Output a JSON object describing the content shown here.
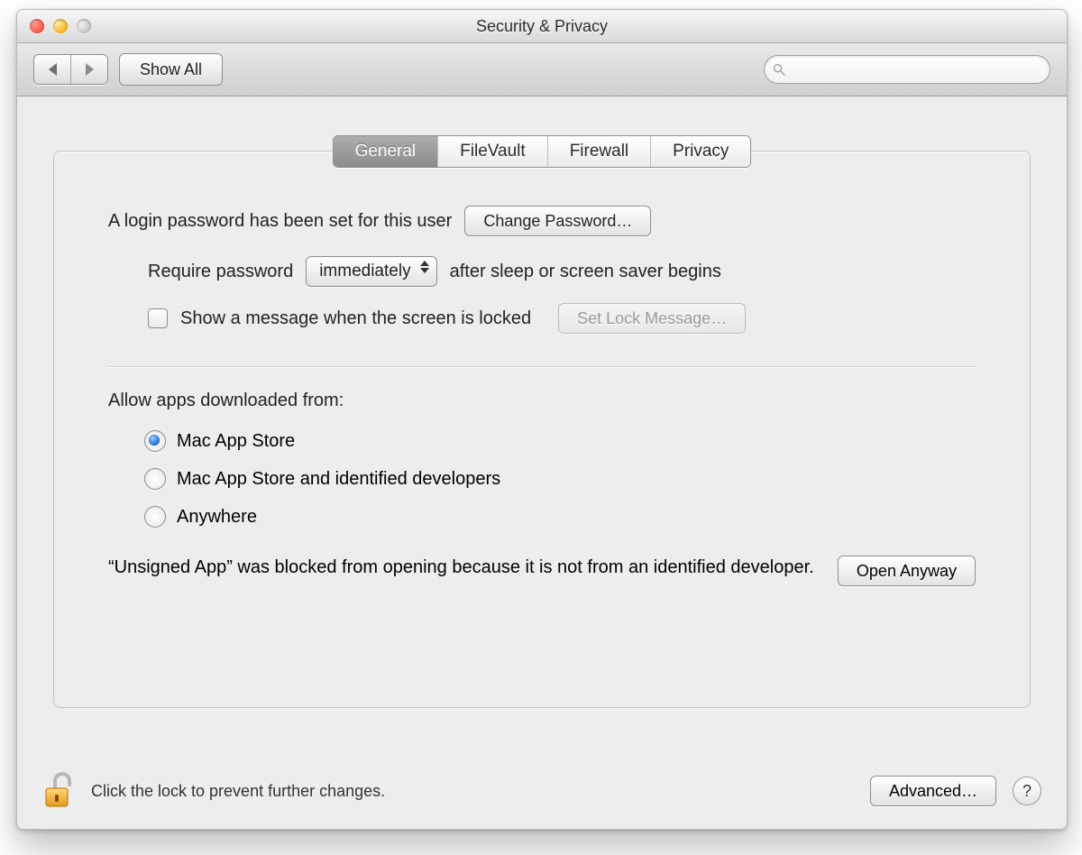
{
  "window": {
    "title": "Security & Privacy"
  },
  "toolbar": {
    "show_all": "Show All",
    "search_placeholder": ""
  },
  "tabs": [
    "General",
    "FileVault",
    "Firewall",
    "Privacy"
  ],
  "active_tab_index": 0,
  "login_password": {
    "status_text": "A login password has been set for this user",
    "change_button": "Change Password…",
    "require_label_pre": "Require password",
    "require_value": "immediately",
    "require_label_post": "after sleep or screen saver begins",
    "show_message_label": "Show a message when the screen is locked",
    "show_message_checked": false,
    "set_lock_button": "Set Lock Message…",
    "set_lock_enabled": false
  },
  "gatekeeper": {
    "heading": "Allow apps downloaded from:",
    "options": [
      "Mac App Store",
      "Mac App Store and identified developers",
      "Anywhere"
    ],
    "selected_index": 0,
    "blocked_text": "“Unsigned App” was blocked from opening because it is not from an identified developer.",
    "open_anyway": "Open Anyway"
  },
  "footer": {
    "lock_text": "Click the lock to prevent further changes.",
    "advanced": "Advanced…"
  }
}
